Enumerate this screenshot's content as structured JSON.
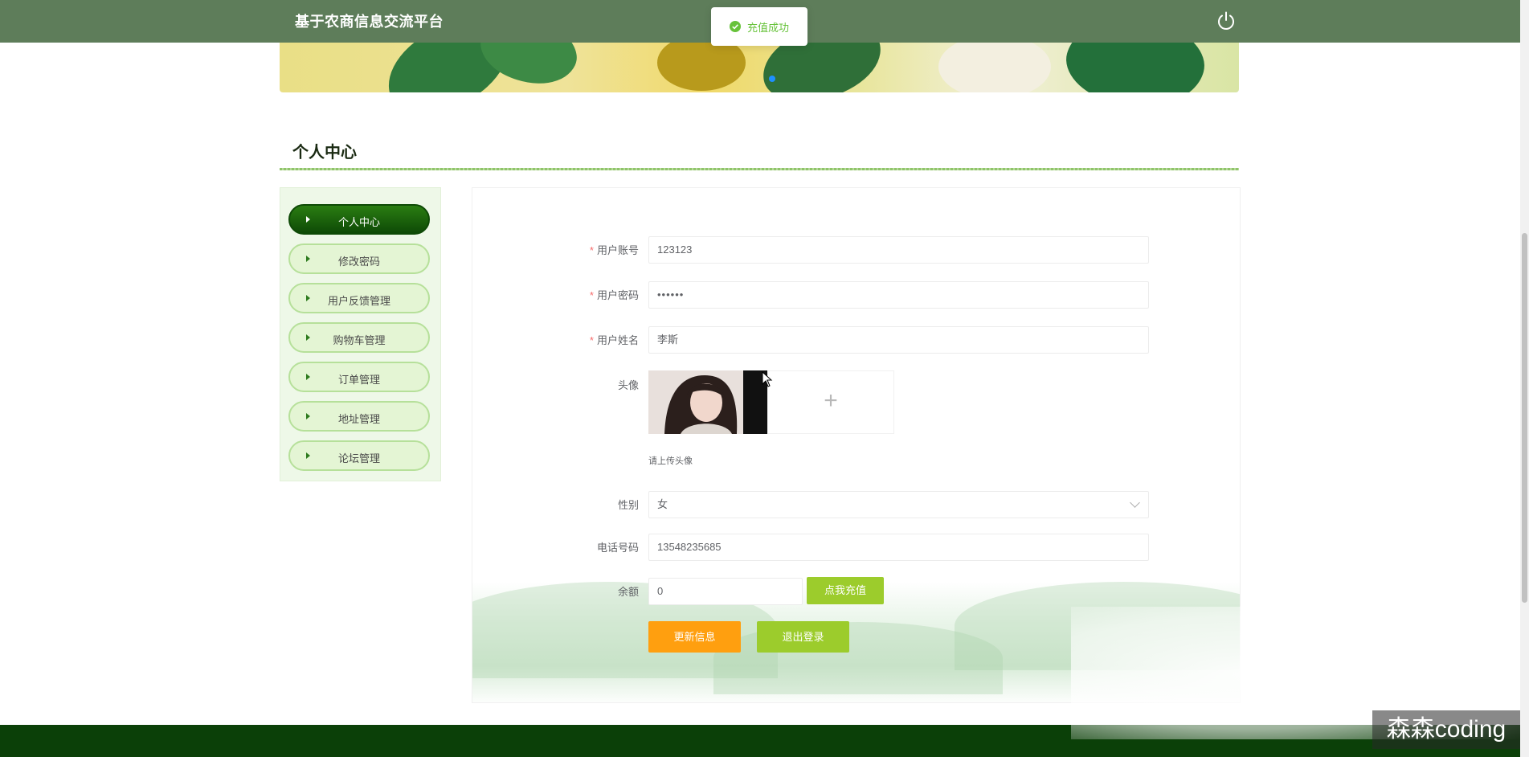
{
  "header": {
    "brand": "基于农商信息交流平台"
  },
  "toast": {
    "message": "充值成功",
    "color": "#67c23a"
  },
  "section": {
    "title": "个人中心"
  },
  "sidebar": {
    "items": [
      {
        "label": "个人中心",
        "active": true
      },
      {
        "label": "修改密码",
        "active": false
      },
      {
        "label": "用户反馈管理",
        "active": false
      },
      {
        "label": "购物车管理",
        "active": false
      },
      {
        "label": "订单管理",
        "active": false
      },
      {
        "label": "地址管理",
        "active": false
      },
      {
        "label": "论坛管理",
        "active": false
      }
    ]
  },
  "form": {
    "account": {
      "label": "用户账号",
      "required_mark": "*",
      "value": "123123"
    },
    "password": {
      "label": "用户密码",
      "required_mark": "*",
      "value": "••••••"
    },
    "name": {
      "label": "用户姓名",
      "required_mark": "*",
      "value": "李斯"
    },
    "avatar": {
      "label": "头像",
      "hint": "请上传头像",
      "add_symbol": "+"
    },
    "gender": {
      "label": "性别",
      "value": "女"
    },
    "phone": {
      "label": "电话号码",
      "value": "13548235685"
    },
    "balance": {
      "label": "余额",
      "value": "0",
      "recharge_label": "点我充值"
    },
    "update_label": "更新信息",
    "logout_label": "退出登录"
  },
  "colors": {
    "header": "#5e7d5a",
    "update_button": "#ff9f0f",
    "logout_button": "#9ccc2c",
    "recharge_button": "#9ccc2c",
    "footer": "#0b4008"
  },
  "watermark": "森森coding"
}
